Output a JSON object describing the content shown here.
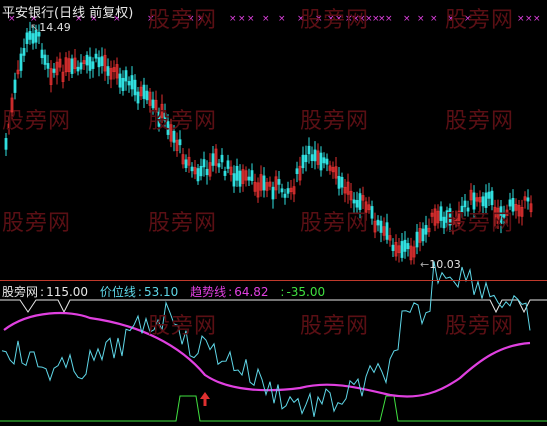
{
  "window": {
    "title": "平安银行(日线 前复权)"
  },
  "watermark": "股旁网",
  "price_panel": {
    "high_label": "14.49",
    "low_label": "10.03",
    "up_color": "#e03030",
    "down_color": "#30e0e0"
  },
  "indicator": {
    "name": "股旁网",
    "value": "115.00",
    "price_line_label": "价位线",
    "price_line_value": "53.10",
    "trend_line_label": "趋势线",
    "trend_line_value": "64.82",
    "extra_value": "-35.00",
    "colors": {
      "name": "#e8e8e8",
      "price": "#5fd7e8",
      "trend": "#e040e0",
      "extra": "#40e040"
    }
  },
  "chart_data": {
    "type": "candlestick",
    "price_max": 14.49,
    "price_min": 10.03
  }
}
